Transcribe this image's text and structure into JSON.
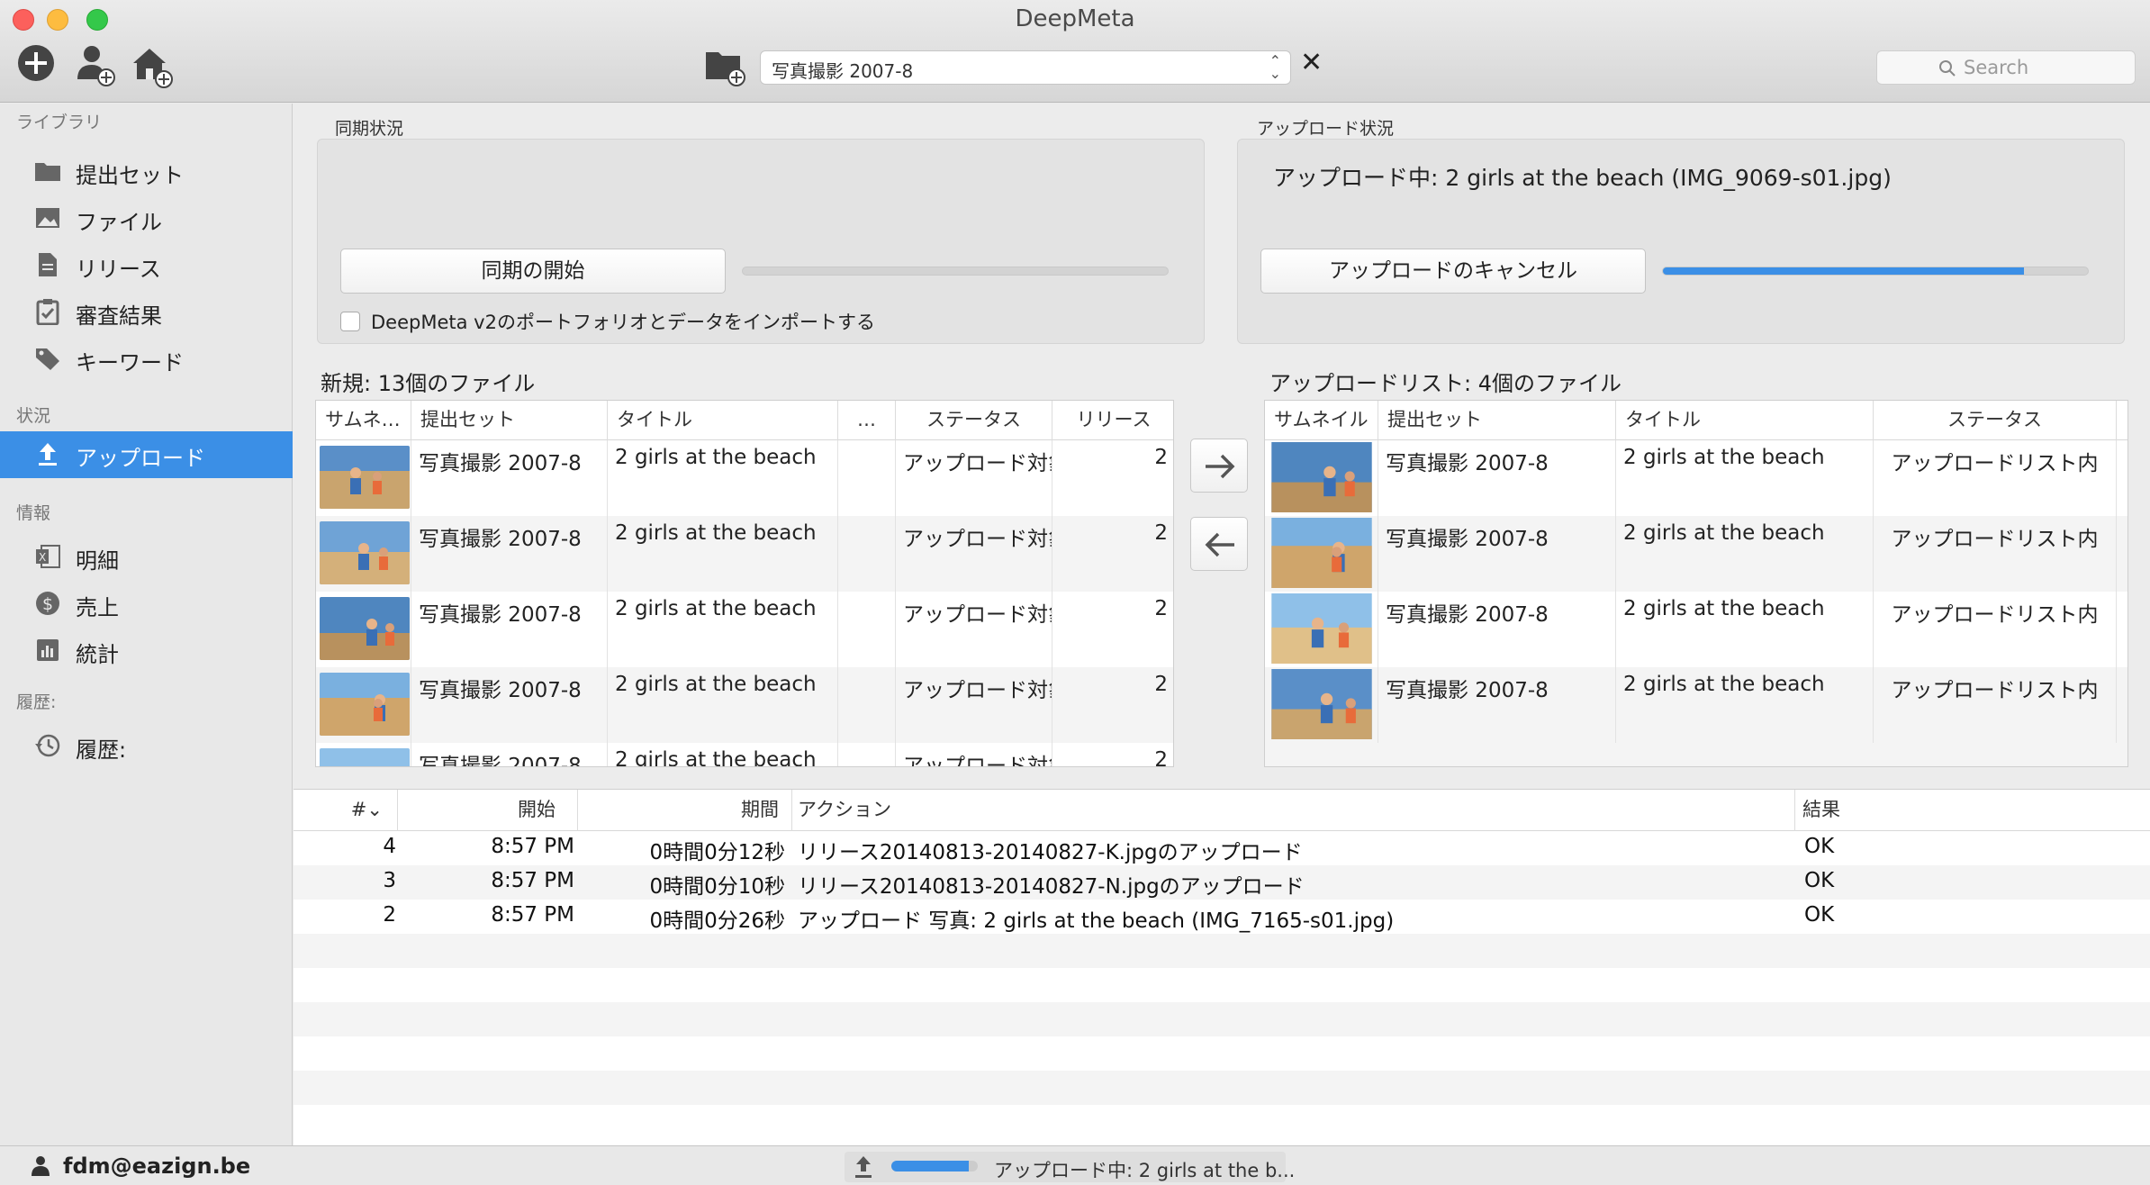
{
  "window": {
    "title": "DeepMeta"
  },
  "toolbar": {
    "set_selector_value": "写真撮影 2007-8",
    "search_placeholder": "Search"
  },
  "sidebar": {
    "sections": [
      "ライブラリ",
      "状況",
      "情報",
      "履歴:"
    ],
    "library_items": [
      {
        "label": "提出セット",
        "icon": "folder-icon"
      },
      {
        "label": "ファイル",
        "icon": "image-icon"
      },
      {
        "label": "リリース",
        "icon": "document-icon"
      },
      {
        "label": "審査結果",
        "icon": "clipboard-check-icon"
      },
      {
        "label": "キーワード",
        "icon": "tag-icon"
      }
    ],
    "status_items": [
      {
        "label": "アップロード",
        "icon": "upload-icon",
        "selected": true
      }
    ],
    "info_items": [
      {
        "label": "明細",
        "icon": "spreadsheet-icon"
      },
      {
        "label": "売上",
        "icon": "dollar-icon"
      },
      {
        "label": "統計",
        "icon": "bar-chart-icon"
      }
    ],
    "history_items": [
      {
        "label": "履歴:",
        "icon": "history-icon"
      }
    ]
  },
  "sync": {
    "group_label": "同期状況",
    "start_button": "同期の開始",
    "progress": 0,
    "import_checkbox_label": "DeepMeta v2のポートフォリオとデータをインポートする",
    "import_checked": false
  },
  "upload": {
    "group_label": "アップロード状況",
    "status_text": "アップロード中: 2 girls at the beach (IMG_9069-s01.jpg)",
    "cancel_button": "アップロードのキャンセル",
    "progress": 0.85
  },
  "new_list": {
    "label": "新規: 13個のファイル",
    "columns": [
      "サムネ…",
      "提出セット",
      "タイトル",
      "…",
      "ステータス",
      "リリース"
    ],
    "rows": [
      {
        "set": "写真撮影 2007-8",
        "title": "2 girls at the beach",
        "extra": "",
        "status": "アップロード対象",
        "release": "2"
      },
      {
        "set": "写真撮影 2007-8",
        "title": "2 girls at the beach",
        "extra": "",
        "status": "アップロード対象",
        "release": "2"
      },
      {
        "set": "写真撮影 2007-8",
        "title": "2 girls at the beach",
        "extra": "",
        "status": "アップロード対象",
        "release": "2"
      },
      {
        "set": "写真撮影 2007-8",
        "title": "2 girls at the beach",
        "extra": "",
        "status": "アップロード対象",
        "release": "2"
      },
      {
        "set": "写真撮影 2007-8",
        "title": "2 girls at the beach",
        "extra": "",
        "status": "アップロード対象",
        "release": "2"
      }
    ]
  },
  "upload_list": {
    "label": "アップロードリスト: 4個のファイル",
    "columns": [
      "サムネイル",
      "提出セット",
      "タイトル",
      "ステータス"
    ],
    "rows": [
      {
        "set": "写真撮影 2007-8",
        "title": "2 girls at the beach",
        "status": "アップロードリスト内"
      },
      {
        "set": "写真撮影 2007-8",
        "title": "2 girls at the beach",
        "status": "アップロードリスト内"
      },
      {
        "set": "写真撮影 2007-8",
        "title": "2 girls at the beach",
        "status": "アップロードリスト内"
      },
      {
        "set": "写真撮影 2007-8",
        "title": "2 girls at the beach",
        "status": "アップロードリスト内"
      }
    ]
  },
  "history": {
    "columns": [
      "#",
      "開始",
      "期間",
      "アクション",
      "結果"
    ],
    "rows": [
      {
        "num": "4",
        "start": "8:57 PM",
        "duration": "0時間0分12秒",
        "action": "リリース20140813-20140827-K.jpgのアップロード",
        "result": "OK"
      },
      {
        "num": "3",
        "start": "8:57 PM",
        "duration": "0時間0分10秒",
        "action": "リリース20140813-20140827-N.jpgのアップロード",
        "result": "OK"
      },
      {
        "num": "2",
        "start": "8:57 PM",
        "duration": "0時間0分26秒",
        "action": "アップロード 写真: 2 girls at the beach (IMG_7165-s01.jpg)",
        "result": "OK"
      }
    ]
  },
  "statusbar": {
    "user": "fdm@eazign.be",
    "upload_text": "アップロード中: 2 girls at the b...",
    "progress": 0.9
  },
  "colors": {
    "accent": "#3b8fe6",
    "selection": "#3b8fe6"
  }
}
